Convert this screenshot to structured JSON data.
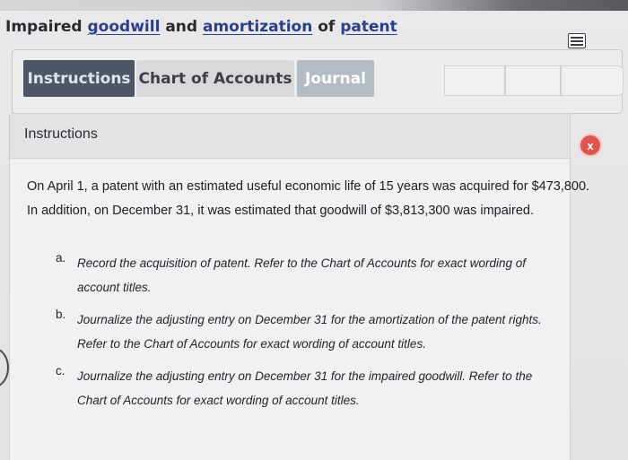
{
  "page": {
    "title_parts": {
      "t1": "Impaired",
      "t2": "goodwill",
      "t3": "and",
      "t4": "amortization",
      "t5": "of",
      "t6": "patent"
    }
  },
  "tabs": [
    {
      "label": "Instructions"
    },
    {
      "label": "Chart of Accounts"
    },
    {
      "label": "Journal"
    }
  ],
  "colors": {
    "link": "#2b3f8f",
    "active_tab": "#4c5766",
    "close_button": "#e0554a"
  },
  "panel": {
    "title": "Instructions",
    "close_label": "x",
    "intro": {
      "line1": "On April 1, a patent with an estimated useful economic life of 15 years was acquired for $473,800.",
      "line2": "In addition, on December 31, it was estimated that goodwill of $3,813,300 was impaired."
    },
    "tasks": [
      {
        "marker": "a.",
        "line1": "Record the acquisition of patent. Refer to the Chart of Accounts for exact wording of",
        "line2": "account titles."
      },
      {
        "marker": "b.",
        "line1": "Journalize the adjusting entry on December 31 for the amortization of the patent rights.",
        "line2": "Refer to the Chart of Accounts for exact wording of account titles."
      },
      {
        "marker": "c.",
        "line1": "Journalize the adjusting entry on December 31 for the impaired goodwill. Refer to the",
        "line2": "Chart of Accounts for exact wording of account titles."
      }
    ]
  },
  "icons": {
    "menu": "menu-icon",
    "close": "close-icon"
  }
}
